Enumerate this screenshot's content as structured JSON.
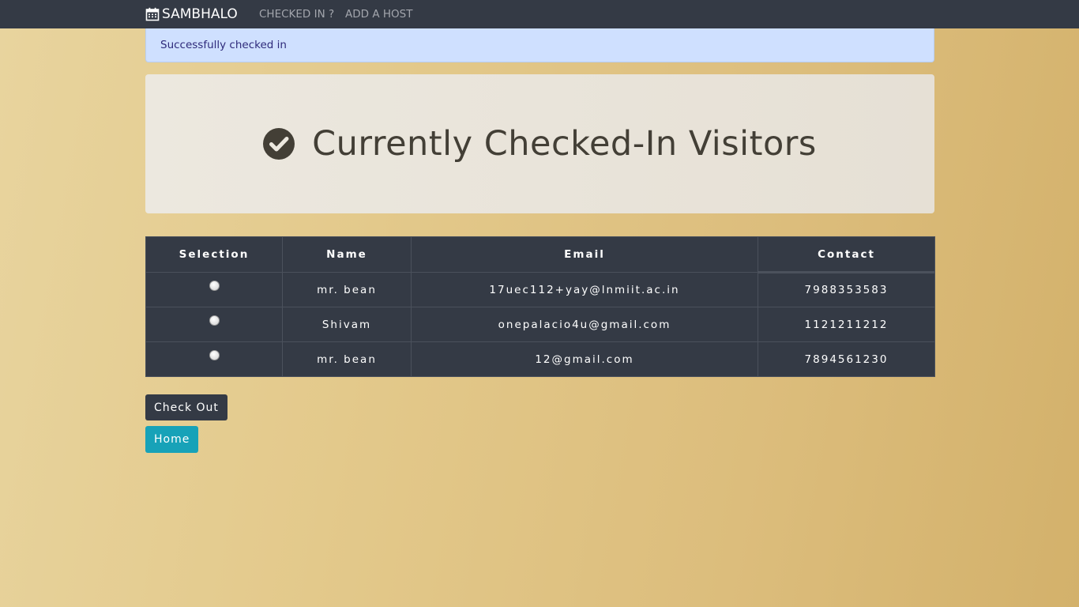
{
  "nav": {
    "brand": "SAMBHALO",
    "links": [
      {
        "label": "CHECKED IN ?"
      },
      {
        "label": "ADD A HOST"
      }
    ]
  },
  "alert": {
    "message": "Successfully checked in"
  },
  "jumbotron": {
    "title": "Currently Checked-In Visitors",
    "icon": "check-circle-icon"
  },
  "table": {
    "headers": [
      "Selection",
      "Name",
      "Email",
      "Contact"
    ],
    "rows": [
      {
        "name": "mr. bean",
        "email": "17uec112+yay@lnmiit.ac.in",
        "contact": "7988353583"
      },
      {
        "name": "Shivam",
        "email": "onepalacio4u@gmail.com",
        "contact": "1121211212"
      },
      {
        "name": "mr. bean",
        "email": "12@gmail.com",
        "contact": "7894561230"
      }
    ]
  },
  "buttons": {
    "checkout": "Check Out",
    "home": "Home"
  },
  "colors": {
    "navbar": "#343a45",
    "alert_bg": "#cfe0ff",
    "home_button": "#17a2b8",
    "table_bg": "#343a45"
  }
}
